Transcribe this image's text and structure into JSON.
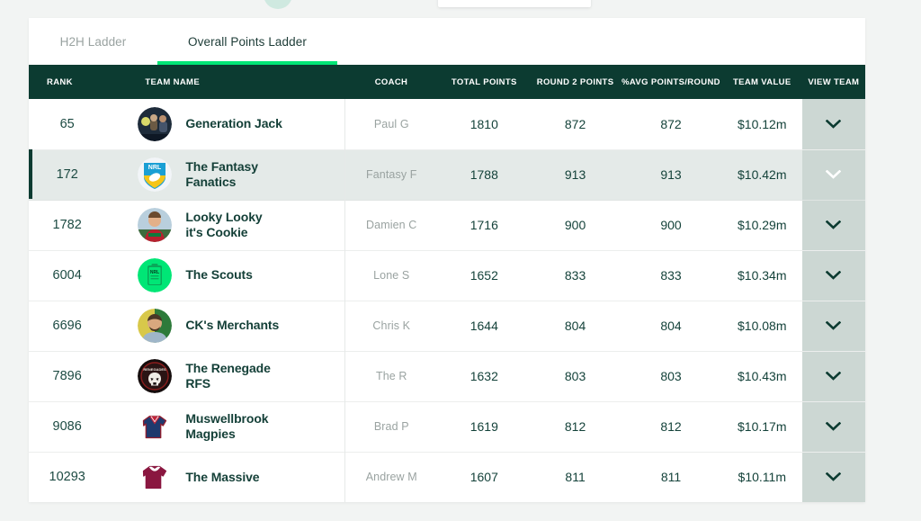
{
  "page": {
    "background_color": "#f2f4f3"
  },
  "top_chrome": {
    "blob_icon": "green-circle-avatar",
    "field_icon": "search-field-partial"
  },
  "tabs": {
    "items": [
      {
        "label": "H2H Ladder",
        "active": false
      },
      {
        "label": "Overall Points Ladder",
        "active": true
      }
    ],
    "active_underline_color": "#00e676"
  },
  "table": {
    "header_bg": "#0c3b31",
    "highlight_bg": "#e4eae8",
    "accent_color": "#0c3b31",
    "view_col_bg": "#ccd7d3",
    "columns": [
      "RANK",
      "TEAM NAME",
      "COACH",
      "TOTAL POINTS",
      "ROUND 2 POINTS",
      "%AVG POINTS/ROUND",
      "TEAM VALUE",
      "VIEW TEAM"
    ],
    "rows": [
      {
        "rank": "65",
        "team_name": "Generation Jack",
        "team_name_line2": "",
        "avatar": "photo-crowd-avatar",
        "coach": "Paul G",
        "total_points": "1810",
        "round_points": "872",
        "avg_points": "872",
        "team_value": "$10.12m",
        "highlight": false,
        "chevron": "chevron-down-icon"
      },
      {
        "rank": "172",
        "team_name": "The Fantasy",
        "team_name_line2": "Fanatics",
        "avatar": "nrl-shield-avatar",
        "coach": "Fantasy F",
        "total_points": "1788",
        "round_points": "913",
        "avg_points": "913",
        "team_value": "$10.42m",
        "highlight": true,
        "chevron": "chevron-down-icon"
      },
      {
        "rank": "1782",
        "team_name": "Looky Looky",
        "team_name_line2": "it's Cookie",
        "avatar": "photo-player-avatar",
        "coach": "Damien C",
        "total_points": "1716",
        "round_points": "900",
        "avg_points": "900",
        "team_value": "$10.29m",
        "highlight": false,
        "chevron": "chevron-down-icon"
      },
      {
        "rank": "6004",
        "team_name": "The Scouts",
        "team_name_line2": "",
        "avatar": "nrl-clipboard-avatar",
        "coach": "Lone S",
        "total_points": "1652",
        "round_points": "833",
        "avg_points": "833",
        "team_value": "$10.34m",
        "highlight": false,
        "chevron": "chevron-down-icon"
      },
      {
        "rank": "6696",
        "team_name": "CK's Merchants",
        "team_name_line2": "",
        "avatar": "photo-man-avatar",
        "coach": "Chris K",
        "total_points": "1644",
        "round_points": "804",
        "avg_points": "804",
        "team_value": "$10.08m",
        "highlight": false,
        "chevron": "chevron-down-icon"
      },
      {
        "rank": "7896",
        "team_name": "The Renegade",
        "team_name_line2": "RFS",
        "avatar": "skull-logo-avatar",
        "coach": "The R",
        "total_points": "1632",
        "round_points": "803",
        "avg_points": "803",
        "team_value": "$10.43m",
        "highlight": false,
        "chevron": "chevron-down-icon"
      },
      {
        "rank": "9086",
        "team_name": "Muswellbrook",
        "team_name_line2": "Magpies",
        "avatar": "jersey-navy-icon",
        "coach": "Brad P",
        "total_points": "1619",
        "round_points": "812",
        "avg_points": "812",
        "team_value": "$10.17m",
        "highlight": false,
        "chevron": "chevron-down-icon"
      },
      {
        "rank": "10293",
        "team_name": "The Massive",
        "team_name_line2": "",
        "avatar": "jersey-maroon-icon",
        "coach": "Andrew M",
        "total_points": "1607",
        "round_points": "811",
        "avg_points": "811",
        "team_value": "$10.11m",
        "highlight": false,
        "chevron": "chevron-down-icon"
      }
    ]
  }
}
